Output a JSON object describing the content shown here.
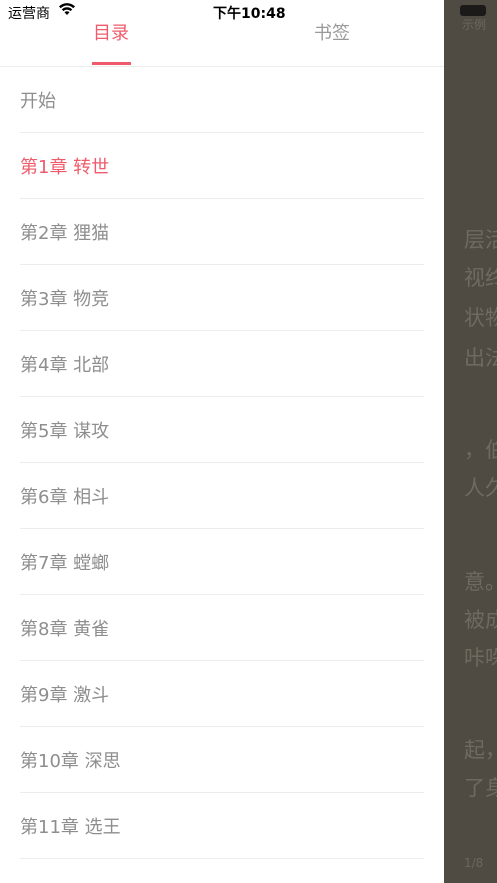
{
  "status_bar": {
    "carrier": "运营商",
    "time": "下午10:48"
  },
  "tabs": [
    {
      "label": "目录",
      "active": true
    },
    {
      "label": "书签",
      "active": false
    }
  ],
  "chapters": [
    {
      "title": "开始"
    },
    {
      "title": "第1章 转世",
      "current": true
    },
    {
      "title": "第2章 狸猫"
    },
    {
      "title": "第3章 物竞"
    },
    {
      "title": "第4章 北部"
    },
    {
      "title": "第5章 谋攻"
    },
    {
      "title": "第6章 相斗"
    },
    {
      "title": "第7章 螳螂"
    },
    {
      "title": "第8章 黄雀"
    },
    {
      "title": "第9章 激斗"
    },
    {
      "title": "第10章 深思"
    },
    {
      "title": "第11章 选王"
    }
  ],
  "reader": {
    "header_text": "示例",
    "lines": [
      "层活",
      "视终",
      "状物",
      "出法",
      "，伯",
      "人久",
      "意。",
      "被成",
      "咔哚",
      "起，",
      "了身"
    ],
    "page_indicator": "1/8"
  },
  "colors": {
    "accent": "#ef5b6a",
    "text_muted": "#8e8e8e",
    "divider": "#ececec"
  }
}
